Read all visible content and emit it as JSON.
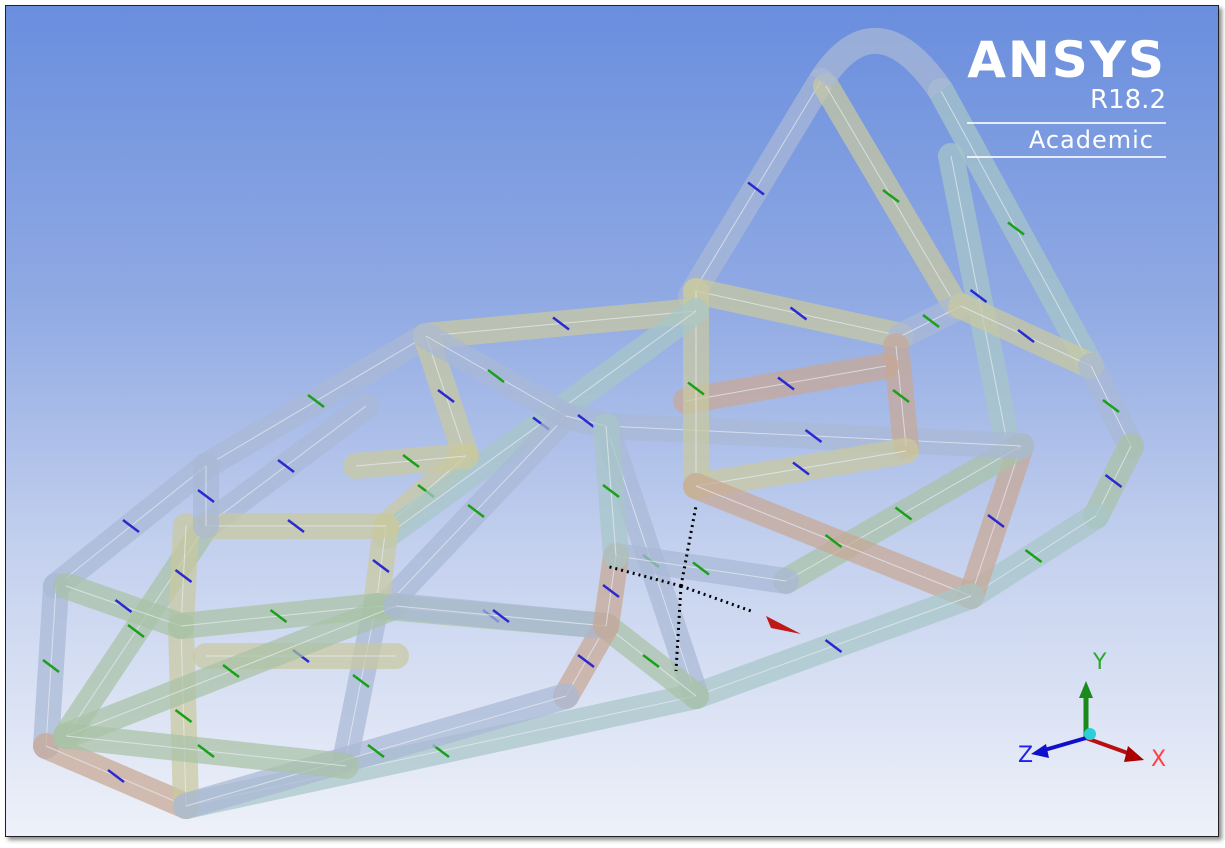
{
  "logo": {
    "name": "ANSYS",
    "version": "R18.2",
    "edition": "Academic"
  },
  "triad": {
    "x_label": "X",
    "y_label": "Y",
    "z_label": "Z",
    "x_color": "#cc1010",
    "y_color": "#1a8a1a",
    "z_color": "#1010cc"
  },
  "model": {
    "type": "tubular-space-frame",
    "display": "transparent"
  }
}
